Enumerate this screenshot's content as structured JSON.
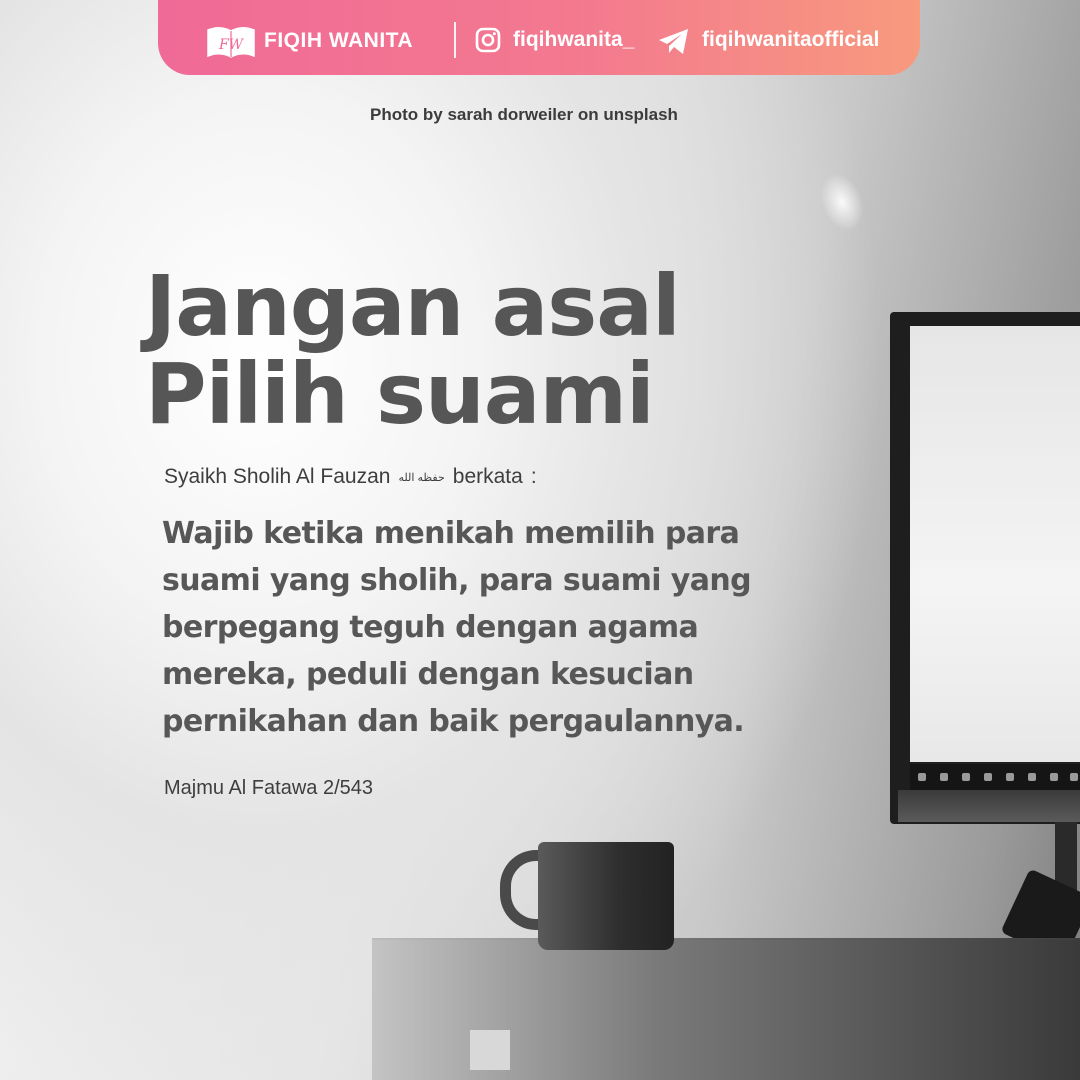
{
  "header": {
    "logo_text": "FW",
    "brand_name": "FIQIH WANITA",
    "instagram_handle": "fiqihwanita_",
    "telegram_handle": "fiqihwanitaofficial",
    "icons": {
      "logo": "book-logo-icon",
      "instagram": "instagram-icon",
      "telegram": "telegram-icon"
    },
    "gradient_colors": [
      "#f06a97",
      "#f89a7e"
    ]
  },
  "photo_credit": "Photo by sarah dorweiler on unsplash",
  "title_line1": "Jangan asal",
  "title_line2": "Pilih suami",
  "author_line": {
    "prefix": "Syaikh Sholih Al Fauzan",
    "honorific": "حفظه الله",
    "suffix": "berkata",
    "colon": ":"
  },
  "quote": "Wajib ketika menikah memilih para suami yang sholih, para suami yang berpegang teguh dengan agama mereka, peduli dengan kesucian pernikahan dan baik pergaulannya.",
  "source": "Majmu Al Fatawa 2/543"
}
